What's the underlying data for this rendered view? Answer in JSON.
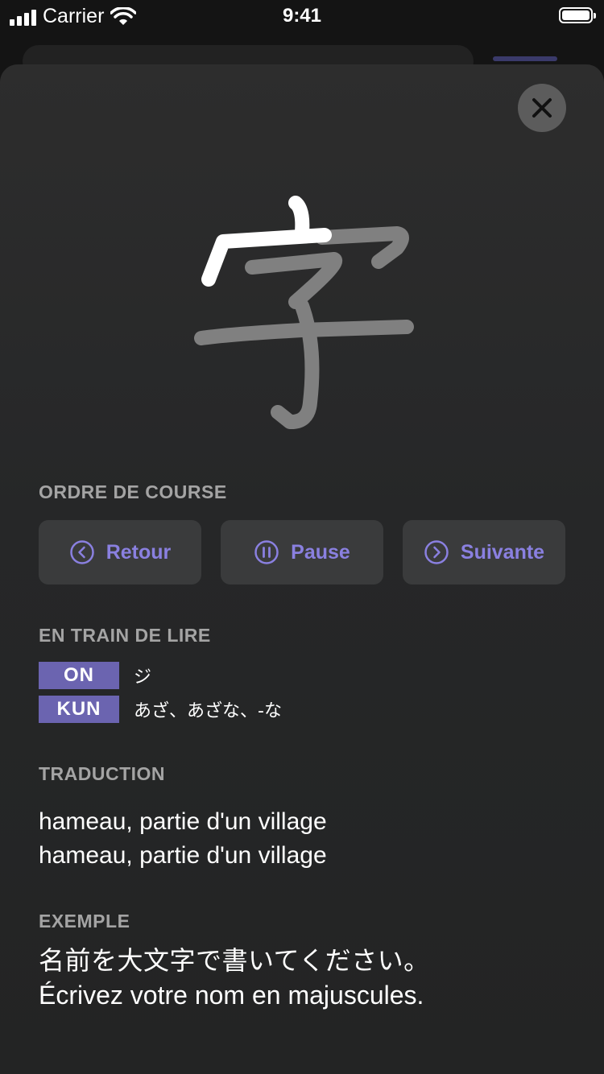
{
  "status_bar": {
    "carrier": "Carrier",
    "time": "9:41"
  },
  "kanji": {
    "character": "字",
    "stroke_color_active": "#ffffff",
    "stroke_color_pending": "#808080"
  },
  "stroke_order": {
    "label": "ORDRE DE COURSE",
    "back_label": "Retour",
    "pause_label": "Pause",
    "next_label": "Suivante"
  },
  "readings": {
    "label": "EN TRAIN DE LIRE",
    "on_tag": "ON",
    "on_value": "ジ",
    "kun_tag": "KUN",
    "kun_value": "あざ、あざな、-な"
  },
  "translation": {
    "label": "TRADUCTION",
    "line1": "hameau, partie d'un village",
    "line2": "hameau, partie d'un village"
  },
  "example": {
    "label": "EXEMPLE",
    "japanese": "名前を大文字で書いてください。",
    "french": "Écrivez votre nom en majuscules."
  },
  "colors": {
    "accent": "#8a80e0",
    "tag_bg": "#6b64b0",
    "section_label": "#a4a4a4"
  }
}
